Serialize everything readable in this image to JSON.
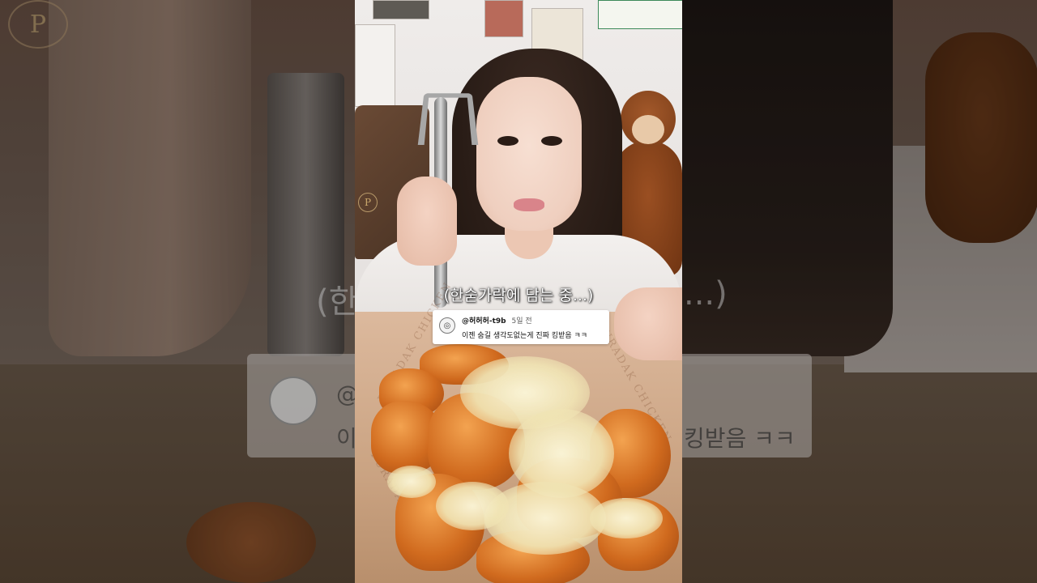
{
  "video": {
    "caption": "(한숟가락에 담는 중...)",
    "backdrop_caption_left": "(한",
    "backdrop_caption_right": "...)",
    "backdrop_comment_left": "@",
    "backdrop_comment_left_text": "이",
    "backdrop_comment_right_text": "킹받음 ㅋㅋ"
  },
  "comment": {
    "handle": "@허허허-t9b",
    "time": "5일 전",
    "text": "이젠 숨길 생각도없는게 진짜 킹받음 ㅋㅋ"
  },
  "scene": {
    "bag_logo": "P",
    "backdrop_logo": "P"
  },
  "colors": {
    "caption_text": "#ffffff",
    "comment_bg": "#ffffff",
    "chicken": "#d06a1e",
    "garlic": "#f5eccb"
  }
}
